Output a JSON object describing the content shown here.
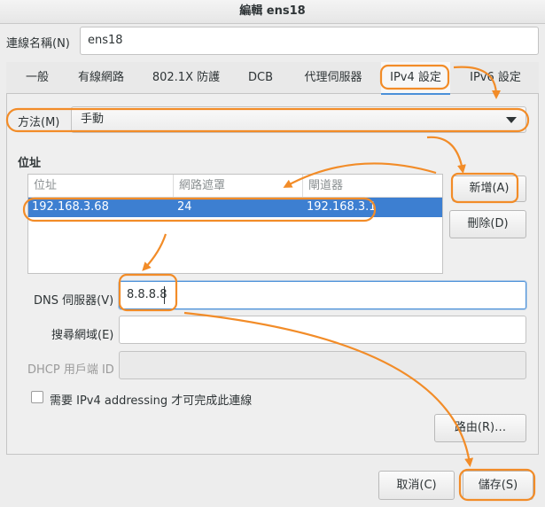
{
  "window": {
    "title": "編輯 ens18"
  },
  "connection_name": {
    "label": "連線名稱(N)",
    "value": "ens18"
  },
  "tabs": [
    {
      "label": "一般"
    },
    {
      "label": "有線網路"
    },
    {
      "label": "802.1X 防護"
    },
    {
      "label": "DCB"
    },
    {
      "label": "代理伺服器"
    },
    {
      "label": "IPv4 設定"
    },
    {
      "label": "IPv6 設定"
    }
  ],
  "active_tab": "IPv4 設定",
  "method": {
    "label": "方法(M)",
    "value": "手動"
  },
  "addresses": {
    "heading": "位址",
    "columns": [
      "位址",
      "網路遮罩",
      "閘道器"
    ],
    "rows": [
      {
        "address": "192.168.3.68",
        "netmask": "24",
        "gateway": "192.168.3.1"
      }
    ],
    "add_button": "新增(A)",
    "delete_button": "刪除(D)"
  },
  "dns": {
    "label": "DNS 伺服器(V)",
    "value": "8.8.8.8"
  },
  "search_domains": {
    "label": "搜尋網域(E)",
    "value": ""
  },
  "dhcp_client_id": {
    "label": "DHCP 用戶端 ID",
    "value": ""
  },
  "require_ipv4": {
    "label": "需要 IPv4 addressing 才可完成此連線",
    "checked": false
  },
  "routes_button": "路由(R)…",
  "footer": {
    "cancel": "取消(C)",
    "save": "儲存(S)"
  },
  "annotation_color": "#f28c28"
}
